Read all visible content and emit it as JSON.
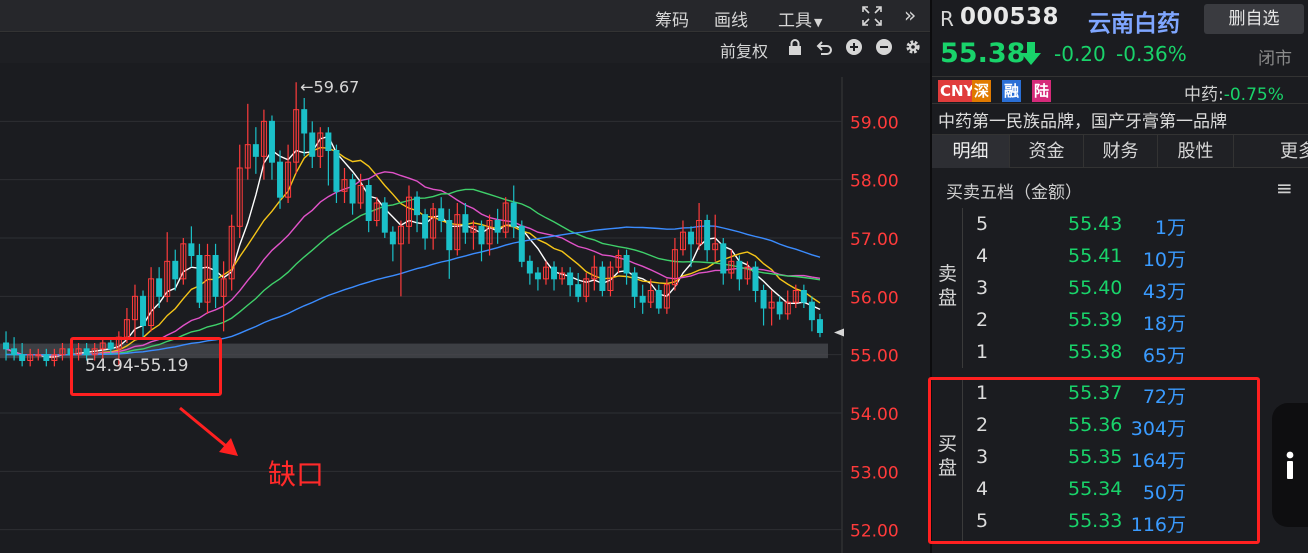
{
  "toolbar": {
    "chips": "筹码",
    "draw": "画线",
    "tools": "工具",
    "fullscreen_icon": "expand-icon",
    "collapse_icon": "double-chevron-right-icon"
  },
  "toolbar2": {
    "adjust": "前复权",
    "icons": [
      "lock-icon",
      "undo-icon",
      "zoom-in-icon",
      "zoom-out-icon",
      "gear-icon"
    ]
  },
  "colors": {
    "up": "#ff3b3b",
    "down": "#1bc0c8",
    "green": "#19d36a",
    "blue": "#3a9bff",
    "highlight": "#ff2020"
  },
  "annotations": {
    "peak_label": "←59.67",
    "gap_range": "54.94-55.19",
    "gap_label": "缺口"
  },
  "chart_data": {
    "type": "candlestick",
    "y_ticks": [
      "59.00",
      "58.00",
      "57.00",
      "56.00",
      "55.00",
      "54.00",
      "53.00",
      "52.00"
    ],
    "ylim": [
      51.6,
      60.0
    ],
    "high": 59.67,
    "gap": [
      54.94,
      55.19
    ],
    "candles": [
      [
        55.2,
        55.1,
        55.4,
        54.9
      ],
      [
        55.1,
        55.0,
        55.3,
        54.9
      ],
      [
        55.0,
        54.9,
        55.2,
        54.8
      ],
      [
        54.9,
        55.0,
        55.1,
        54.8
      ],
      [
        55.0,
        55.0,
        55.1,
        54.9
      ],
      [
        55.0,
        54.9,
        55.1,
        54.8
      ],
      [
        54.9,
        55.0,
        55.1,
        54.8
      ],
      [
        55.0,
        55.1,
        55.2,
        54.9
      ],
      [
        55.1,
        55.0,
        55.2,
        54.9
      ],
      [
        55.0,
        55.1,
        55.2,
        54.9
      ],
      [
        55.1,
        55.0,
        55.2,
        54.9
      ],
      [
        55.0,
        55.1,
        55.2,
        54.9
      ],
      [
        55.1,
        55.2,
        55.3,
        54.9
      ],
      [
        55.2,
        55.1,
        55.3,
        55.0
      ],
      [
        55.1,
        55.3,
        55.4,
        54.8
      ],
      [
        55.3,
        55.6,
        55.8,
        55.2
      ],
      [
        55.6,
        56.0,
        56.2,
        55.3
      ],
      [
        56.0,
        55.5,
        56.1,
        55.3
      ],
      [
        55.5,
        56.3,
        56.5,
        55.4
      ],
      [
        56.3,
        56.0,
        56.5,
        55.8
      ],
      [
        56.0,
        56.6,
        57.1,
        55.9
      ],
      [
        56.6,
        56.3,
        56.8,
        56.1
      ],
      [
        56.3,
        56.9,
        57.0,
        56.2
      ],
      [
        56.9,
        56.7,
        57.2,
        56.5
      ],
      [
        56.7,
        55.9,
        56.9,
        55.8
      ],
      [
        55.9,
        56.7,
        56.9,
        55.7
      ],
      [
        56.7,
        56.0,
        56.9,
        55.8
      ],
      [
        56.0,
        56.3,
        56.6,
        55.4
      ],
      [
        56.3,
        57.2,
        57.4,
        56.1
      ],
      [
        57.2,
        58.2,
        58.6,
        57.0
      ],
      [
        58.2,
        58.6,
        59.3,
        58.0
      ],
      [
        58.6,
        58.4,
        58.9,
        58.1
      ],
      [
        58.4,
        59.0,
        59.2,
        58.0
      ],
      [
        59.0,
        58.3,
        59.1,
        58.0
      ],
      [
        58.3,
        57.7,
        58.5,
        57.5
      ],
      [
        57.7,
        58.3,
        58.6,
        57.6
      ],
      [
        58.3,
        59.2,
        59.67,
        58.1
      ],
      [
        59.2,
        58.8,
        59.4,
        58.4
      ],
      [
        58.8,
        58.4,
        59.0,
        58.2
      ],
      [
        58.4,
        58.8,
        58.9,
        58.2
      ],
      [
        58.8,
        58.5,
        58.9,
        57.9
      ],
      [
        58.5,
        57.8,
        58.6,
        57.6
      ],
      [
        57.8,
        58.0,
        58.2,
        57.6
      ],
      [
        58.0,
        57.6,
        58.1,
        57.4
      ],
      [
        57.6,
        57.9,
        58.1,
        57.5
      ],
      [
        57.9,
        57.3,
        58.0,
        57.1
      ],
      [
        57.3,
        57.6,
        57.7,
        57.2
      ],
      [
        57.6,
        57.1,
        57.7,
        57.0
      ],
      [
        57.1,
        56.9,
        57.2,
        56.6
      ],
      [
        56.9,
        57.2,
        57.3,
        56.0
      ],
      [
        57.2,
        57.7,
        57.9,
        56.9
      ],
      [
        57.7,
        57.4,
        57.8,
        57.1
      ],
      [
        57.4,
        57.0,
        57.5,
        56.8
      ],
      [
        57.0,
        57.5,
        57.6,
        56.8
      ],
      [
        57.5,
        57.3,
        57.7,
        57.1
      ],
      [
        57.3,
        56.8,
        57.5,
        56.3
      ],
      [
        56.8,
        57.4,
        57.6,
        56.7
      ],
      [
        57.4,
        57.1,
        57.6,
        56.9
      ],
      [
        57.1,
        57.2,
        57.3,
        56.8
      ],
      [
        57.2,
        56.9,
        57.3,
        56.6
      ],
      [
        56.9,
        57.3,
        57.4,
        56.7
      ],
      [
        57.3,
        57.1,
        57.5,
        56.9
      ],
      [
        57.1,
        57.6,
        57.7,
        57.0
      ],
      [
        57.6,
        57.2,
        57.9,
        57.0
      ],
      [
        57.2,
        56.6,
        57.3,
        56.5
      ],
      [
        56.6,
        56.4,
        56.7,
        56.2
      ],
      [
        56.4,
        56.3,
        56.5,
        56.1
      ],
      [
        56.3,
        56.5,
        56.6,
        56.2
      ],
      [
        56.5,
        56.3,
        56.6,
        56.1
      ],
      [
        56.3,
        56.4,
        56.5,
        56.2
      ],
      [
        56.4,
        56.2,
        56.5,
        56.0
      ],
      [
        56.2,
        56.0,
        56.4,
        55.9
      ],
      [
        56.0,
        56.3,
        56.4,
        55.9
      ],
      [
        56.3,
        56.5,
        56.7,
        56.1
      ],
      [
        56.5,
        56.1,
        56.6,
        56.0
      ],
      [
        56.1,
        56.5,
        56.6,
        56.0
      ],
      [
        56.5,
        56.7,
        56.8,
        56.4
      ],
      [
        56.7,
        56.4,
        56.8,
        56.2
      ],
      [
        56.4,
        56.0,
        56.5,
        55.8
      ],
      [
        56.0,
        55.9,
        56.2,
        55.7
      ],
      [
        55.9,
        56.1,
        56.3,
        55.8
      ],
      [
        56.1,
        55.8,
        56.2,
        55.7
      ],
      [
        55.8,
        56.2,
        56.3,
        55.7
      ],
      [
        56.2,
        56.8,
        57.0,
        56.1
      ],
      [
        56.8,
        57.1,
        57.3,
        56.7
      ],
      [
        57.1,
        56.9,
        57.2,
        56.5
      ],
      [
        56.9,
        57.3,
        57.6,
        56.8
      ],
      [
        57.3,
        56.8,
        57.4,
        56.6
      ],
      [
        56.8,
        56.9,
        57.4,
        56.6
      ],
      [
        56.9,
        56.4,
        57.0,
        56.2
      ],
      [
        56.4,
        56.6,
        56.8,
        56.3
      ],
      [
        56.6,
        56.3,
        56.7,
        56.1
      ],
      [
        56.3,
        56.5,
        56.6,
        56.2
      ],
      [
        56.5,
        56.1,
        56.6,
        55.9
      ],
      [
        56.1,
        55.8,
        56.2,
        55.5
      ],
      [
        55.8,
        55.9,
        56.1,
        55.5
      ],
      [
        55.9,
        55.7,
        56.0,
        55.6
      ],
      [
        55.7,
        55.9,
        56.1,
        55.6
      ],
      [
        55.9,
        56.1,
        56.2,
        55.8
      ],
      [
        56.1,
        55.9,
        56.2,
        55.8
      ],
      [
        55.9,
        55.6,
        56.0,
        55.4
      ],
      [
        55.6,
        55.38,
        55.7,
        55.3
      ]
    ],
    "ma_series": [
      {
        "color": "#ffffff",
        "period": 5
      },
      {
        "color": "#f5c518",
        "period": 10
      },
      {
        "color": "#e052c8",
        "period": 20
      },
      {
        "color": "#3fd06a",
        "period": 30
      },
      {
        "color": "#3b8cff",
        "period": 60
      }
    ]
  },
  "stock": {
    "prefix": "R",
    "code": "000538",
    "name": "云南白药",
    "remove_watch": "删自选",
    "price": "55.38",
    "change": "-0.20",
    "change_pct": "-0.36%",
    "status": "闭市",
    "badges": [
      {
        "text": "CNY",
        "bg": "#e03c3c"
      },
      {
        "text": "深",
        "bg": "#e07a00"
      },
      {
        "text": "融",
        "bg": "#2a6fd6"
      },
      {
        "text": "陆",
        "bg": "#d62a7a"
      }
    ],
    "sector_name": "中药:",
    "sector_change": "-0.75%",
    "tagline": "中药第一民族品牌，国产牙膏第一品牌"
  },
  "tabs": [
    "明细",
    "资金",
    "财务",
    "股性",
    "更多"
  ],
  "orderbook": {
    "title": "买卖五档（金额）",
    "sell_label": "卖盘",
    "buy_label": "买盘",
    "sell": [
      {
        "level": "5",
        "price": "55.43",
        "vol": "1万"
      },
      {
        "level": "4",
        "price": "55.41",
        "vol": "10万"
      },
      {
        "level": "3",
        "price": "55.40",
        "vol": "43万"
      },
      {
        "level": "2",
        "price": "55.39",
        "vol": "18万"
      },
      {
        "level": "1",
        "price": "55.38",
        "vol": "65万"
      }
    ],
    "buy": [
      {
        "level": "1",
        "price": "55.37",
        "vol": "72万"
      },
      {
        "level": "2",
        "price": "55.36",
        "vol": "304万"
      },
      {
        "level": "3",
        "price": "55.35",
        "vol": "164万"
      },
      {
        "level": "4",
        "price": "55.34",
        "vol": "50万"
      },
      {
        "level": "5",
        "price": "55.33",
        "vol": "116万"
      }
    ]
  }
}
